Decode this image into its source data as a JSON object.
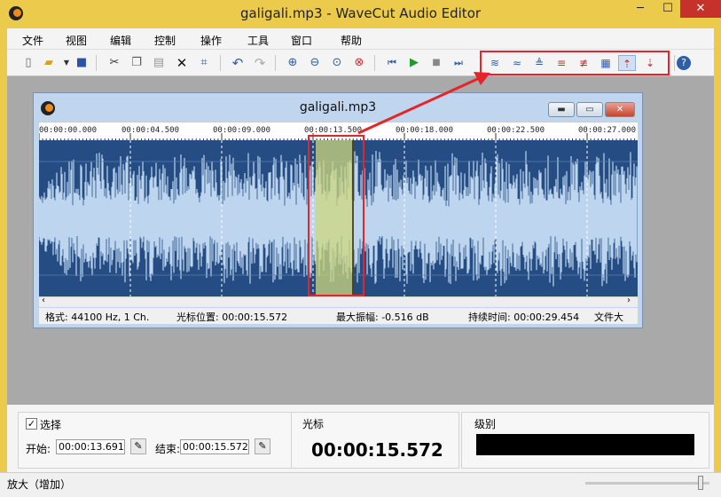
{
  "app": {
    "title": "galigali.mp3 - WaveCut Audio Editor"
  },
  "window_controls": {
    "minimize": "─",
    "maximize": "☐",
    "close": "✕"
  },
  "menu": [
    "文件",
    "视图",
    "编辑",
    "控制",
    "操作",
    "工具",
    "窗口",
    "帮助"
  ],
  "child": {
    "title": "galigali.mp3",
    "controls": {
      "minimize": "▬",
      "maximize": "▭",
      "close": "✕"
    }
  },
  "ruler": {
    "ticks": [
      "00:00:00.000",
      "00:00:04.500",
      "00:00:09.000",
      "00:00:13.500",
      "00:00:18.000",
      "00:00:22.500",
      "00:00:27.000"
    ]
  },
  "status": {
    "format": "格式: 44100 Hz, 1 Ch.",
    "cursor": "光标位置: 00:00:15.572",
    "peak": "最大振幅: -0.516 dB",
    "duration": "持续时间: 00:00:29.454",
    "size": "文件大"
  },
  "selection": {
    "checkbox_label": "选择",
    "checked": true,
    "start_label": "开始:",
    "start_value": "00:00:13.691",
    "end_label": "结束:",
    "end_value": "00:00:15.572"
  },
  "cursor_panel": {
    "title": "光标",
    "time": "00:00:15.572"
  },
  "level_panel": {
    "title": "级别"
  },
  "statusbar": {
    "text": "放大（增加）"
  },
  "colors": {
    "accent_yellow": "#eccb4c",
    "wave_bg": "#254d84",
    "wave_fg": "#bdd5ef",
    "selection": "#cdd77e",
    "highlight_red": "#e3262a"
  }
}
